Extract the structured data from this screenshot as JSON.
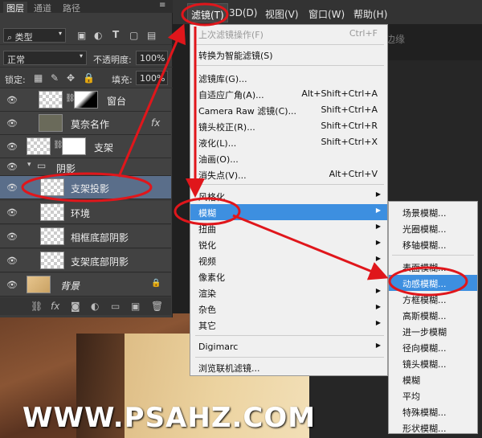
{
  "menubar": {
    "filter": "滤镜(T)",
    "three_d": "3D(D)",
    "view": "视图(V)",
    "window": "窗口(W)",
    "help": "帮助(H)",
    "edge_text": "边缘"
  },
  "panel": {
    "tabs": [
      "图层",
      "通道",
      "路径"
    ],
    "kind_label": "类型",
    "blend_mode": "正常",
    "opacity_label": "不透明度:",
    "opacity_value": "100%",
    "lock_label": "锁定:",
    "fill_label": "填充:",
    "fill_value": "100%",
    "layers": [
      {
        "name": "窗台"
      },
      {
        "name": "莫奈名作",
        "fx": "fx"
      },
      {
        "name": "支架"
      },
      {
        "name": "阴影"
      },
      {
        "name": "支架投影"
      },
      {
        "name": "环境"
      },
      {
        "name": "相框底部阴影"
      },
      {
        "name": "支架底部阴影"
      },
      {
        "name": "背景"
      }
    ]
  },
  "filter_menu": {
    "items": [
      {
        "label": "上次滤镜操作(F)",
        "shortcut": "Ctrl+F"
      },
      {
        "label": "转换为智能滤镜(S)"
      },
      {
        "label": "滤镜库(G)..."
      },
      {
        "label": "自适应广角(A)...",
        "shortcut": "Alt+Shift+Ctrl+A"
      },
      {
        "label": "Camera Raw 滤镜(C)...",
        "shortcut": "Shift+Ctrl+A"
      },
      {
        "label": "镜头校正(R)...",
        "shortcut": "Shift+Ctrl+R"
      },
      {
        "label": "液化(L)...",
        "shortcut": "Shift+Ctrl+X"
      },
      {
        "label": "油画(O)..."
      },
      {
        "label": "消失点(V)...",
        "shortcut": "Alt+Ctrl+V"
      },
      {
        "label": "风格化"
      },
      {
        "label": "模糊"
      },
      {
        "label": "扭曲"
      },
      {
        "label": "锐化"
      },
      {
        "label": "视频"
      },
      {
        "label": "像素化"
      },
      {
        "label": "渲染"
      },
      {
        "label": "杂色"
      },
      {
        "label": "其它"
      },
      {
        "label": "Digimarc"
      },
      {
        "label": "浏览联机滤镜..."
      }
    ]
  },
  "blur_menu": {
    "items": [
      "场景模糊...",
      "光圈模糊...",
      "移轴模糊...",
      "表面模糊...",
      "动感模糊...",
      "方框模糊...",
      "高斯模糊...",
      "进一步模糊",
      "径向模糊...",
      "镜头模糊...",
      "模糊",
      "平均",
      "特殊模糊...",
      "形状模糊..."
    ]
  },
  "watermark": "WWW.PSAHZ.COM",
  "colors": {
    "highlight": "#3d8fe0",
    "annotation": "#e0161b"
  }
}
